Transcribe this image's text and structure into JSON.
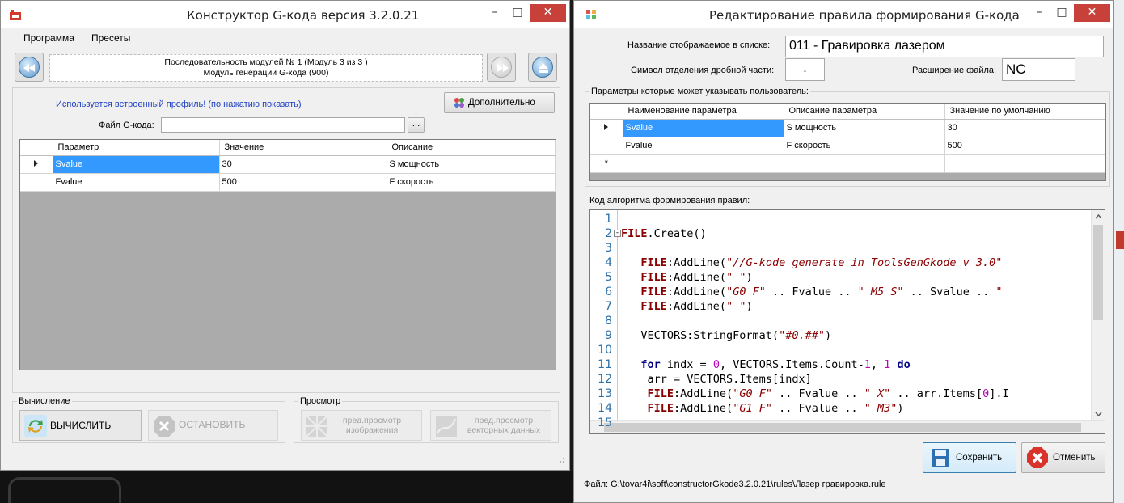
{
  "left_window": {
    "title": "Конструктор G-кода версия 3.2.0.21",
    "controls": {
      "minimize": "–",
      "maximize": "□",
      "close": "✕"
    },
    "menu": [
      "Программа",
      "Пресеты"
    ],
    "sequence": {
      "line1": "Последовательность модулей № 1 (Модуль 3 из 3 )",
      "line2": "Модуль генерации G-кода (900)"
    },
    "profile_link": "Используется встроенный профиль! (по нажатию показать)",
    "more_button": "Дополнительно",
    "gcode_file_label": "Файл G-кода:",
    "gcode_file_value": "",
    "browse_button": "...",
    "params_table": {
      "headers": [
        "Параметр",
        "Значение",
        "Описание"
      ],
      "rows": [
        {
          "name": "Svalue",
          "value": "30",
          "desc": "S мощность"
        },
        {
          "name": "Fvalue",
          "value": "500",
          "desc": "F скорость"
        }
      ]
    },
    "calc_group": "Вычисление",
    "calc_button": "ВЫЧИСЛИТЬ",
    "stop_button": "ОСТАНОВИТЬ",
    "view_group": "Просмотр",
    "preview_image_button": "пред.просмотр изображения",
    "preview_vector_button": "пред.просмотр векторных данных"
  },
  "right_window": {
    "title": "Редактирование правила формирования G-кода",
    "controls": {
      "minimize": "–",
      "maximize": "□",
      "close": "✕"
    },
    "name_label": "Название отображаемое в списке:",
    "name_value": "011 - Гравировка лазером",
    "decimal_label": "Символ отделения дробной части:",
    "decimal_value": ".",
    "ext_label": "Расширение файла:",
    "ext_value": "NC",
    "user_params_group": "Параметры которые может указывать пользователь:",
    "user_params_table": {
      "headers": [
        "Наименование параметра",
        "Описание параметра",
        "Значение по умолчанию"
      ],
      "rows": [
        {
          "name": "Svalue",
          "desc": "S мощность",
          "default": "30"
        },
        {
          "name": "Fvalue",
          "desc": "F скорость",
          "default": "500"
        }
      ],
      "new_row_marker": "*"
    },
    "code_label": "Код алгоритма формирования правил:",
    "code_lines": [
      {
        "n": "1",
        "segs": []
      },
      {
        "n": "2",
        "segs": [
          [
            "kw",
            "FILE"
          ],
          [
            "",
            "."
          ],
          [
            "",
            "Create()"
          ]
        ]
      },
      {
        "n": "3",
        "segs": []
      },
      {
        "n": "4",
        "segs": [
          [
            "",
            "   "
          ],
          [
            "kw",
            "FILE"
          ],
          [
            "",
            ":AddLine("
          ],
          [
            "str",
            "\"//G-kode generate in ToolsGenGkode v 3.0\""
          ]
        ]
      },
      {
        "n": "5",
        "segs": [
          [
            "",
            "   "
          ],
          [
            "kw",
            "FILE"
          ],
          [
            "",
            ":AddLine("
          ],
          [
            "str",
            "\" \""
          ],
          [
            "",
            ")"
          ]
        ]
      },
      {
        "n": "6",
        "segs": [
          [
            "",
            "   "
          ],
          [
            "kw",
            "FILE"
          ],
          [
            "",
            ":AddLine("
          ],
          [
            "str",
            "\"G0 F\""
          ],
          [
            "",
            " .. Fvalue .. "
          ],
          [
            "str",
            "\" M5 S\""
          ],
          [
            "",
            " .. Svalue .. "
          ],
          [
            "str",
            "\""
          ]
        ]
      },
      {
        "n": "7",
        "segs": [
          [
            "",
            "   "
          ],
          [
            "kw",
            "FILE"
          ],
          [
            "",
            ":AddLine("
          ],
          [
            "str",
            "\" \""
          ],
          [
            "",
            ")"
          ]
        ]
      },
      {
        "n": "8",
        "segs": []
      },
      {
        "n": "9",
        "segs": [
          [
            "",
            "   VECTORS:StringFormat("
          ],
          [
            "str",
            "\"#0.##\""
          ],
          [
            "",
            ")"
          ]
        ]
      },
      {
        "n": "10",
        "segs": []
      },
      {
        "n": "11",
        "segs": [
          [
            "",
            "   "
          ],
          [
            "kw2",
            "for"
          ],
          [
            "",
            " indx = "
          ],
          [
            "num",
            "0"
          ],
          [
            "",
            ", VECTORS.Items.Count-"
          ],
          [
            "num",
            "1"
          ],
          [
            "",
            ", "
          ],
          [
            "num",
            "1"
          ],
          [
            "",
            " "
          ],
          [
            "kw2",
            "do"
          ]
        ]
      },
      {
        "n": "12",
        "segs": [
          [
            "",
            "    arr = VECTORS.Items[indx]"
          ]
        ]
      },
      {
        "n": "13",
        "segs": [
          [
            "",
            "    "
          ],
          [
            "kw",
            "FILE"
          ],
          [
            "",
            ":AddLine("
          ],
          [
            "str",
            "\"G0 F\""
          ],
          [
            "",
            " .. Fvalue .. "
          ],
          [
            "str",
            "\" X\""
          ],
          [
            "",
            " .. arr.Items["
          ],
          [
            "num",
            "0"
          ],
          [
            "",
            "].I"
          ]
        ]
      },
      {
        "n": "14",
        "segs": [
          [
            "",
            "    "
          ],
          [
            "kw",
            "FILE"
          ],
          [
            "",
            ":AddLine("
          ],
          [
            "str",
            "\"G1 F\""
          ],
          [
            "",
            " .. Fvalue .. "
          ],
          [
            "str",
            "\" M3\""
          ],
          [
            "",
            ")"
          ]
        ]
      },
      {
        "n": "15",
        "segs": []
      }
    ],
    "save_button": "Сохранить",
    "cancel_button": "Отменить",
    "status_path": "Файл: G:\\tovar4i\\soft\\constructorGkode3.2.0.21\\rules\\Лазер гравировка.rule"
  },
  "colors": {
    "selection": "#3399ff",
    "close_button": "#c7413a",
    "link": "#1d3fc3",
    "keyword": "#8b0000",
    "loop_keyword": "#00008b",
    "number": "#b40ab4"
  }
}
